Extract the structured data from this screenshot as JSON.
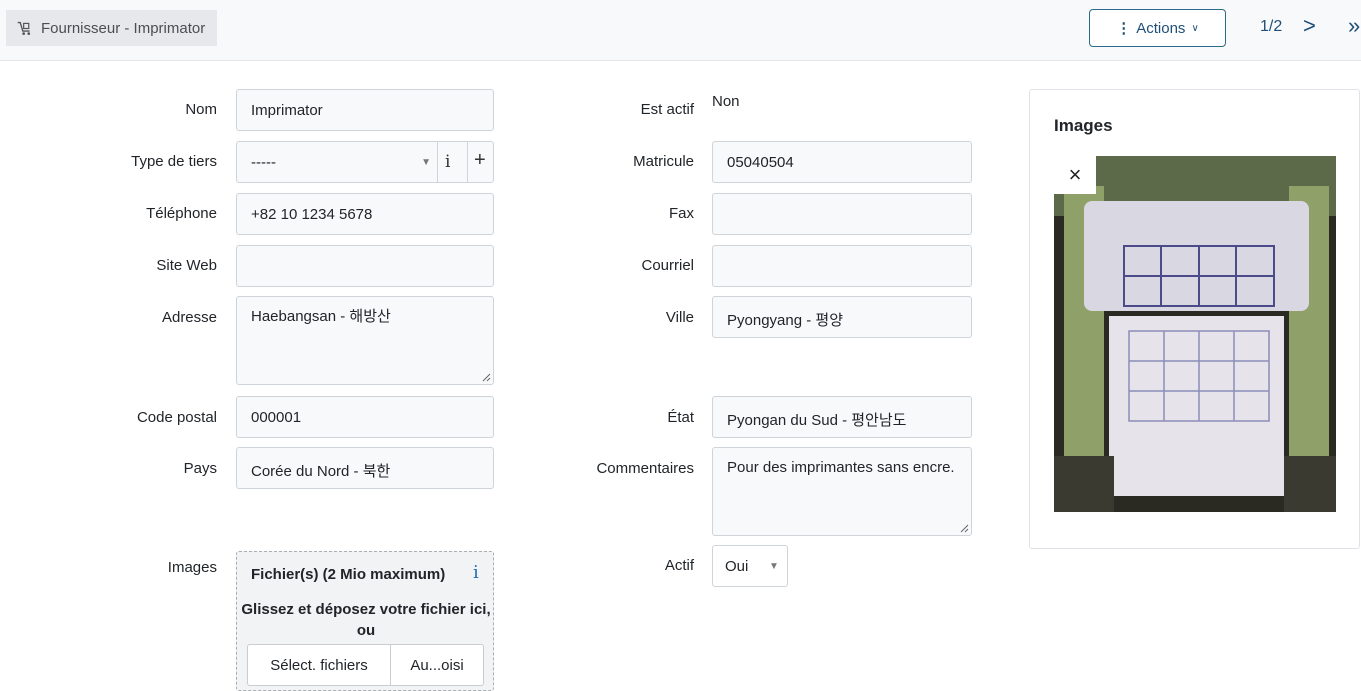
{
  "header": {
    "breadcrumb": "Fournisseur - Imprimator",
    "actions_label": "Actions",
    "pager": "1/2",
    "prev_label": ">",
    "next_label": "»"
  },
  "form": {
    "nom": {
      "label": "Nom",
      "value": "Imprimator"
    },
    "type_tiers": {
      "label": "Type de tiers",
      "value": "-----",
      "info": "i",
      "add": "+"
    },
    "telephone": {
      "label": "Téléphone",
      "value": "+82 10 1234 5678"
    },
    "site_web": {
      "label": "Site Web",
      "value": ""
    },
    "adresse": {
      "label": "Adresse",
      "value": "Haebangsan - 해방산"
    },
    "code_postal": {
      "label": "Code postal",
      "value": "000001"
    },
    "pays": {
      "label": "Pays",
      "value": "Corée du Nord - 북한"
    },
    "images": {
      "label": "Images"
    },
    "est_actif": {
      "label": "Est actif",
      "value": "Non"
    },
    "matricule": {
      "label": "Matricule",
      "value": "05040504"
    },
    "fax": {
      "label": "Fax",
      "value": ""
    },
    "courriel": {
      "label": "Courriel",
      "value": ""
    },
    "ville": {
      "label": "Ville",
      "value": "Pyongyang - 평양"
    },
    "etat": {
      "label": "État",
      "value": "Pyongan du Sud - 평안남도"
    },
    "commentaires": {
      "label": "Commentaires",
      "value": "Pour des imprimantes sans encre."
    },
    "actif": {
      "label": "Actif",
      "value": "Oui"
    }
  },
  "dropzone": {
    "title": "Fichier(s) (2 Mio maximum)",
    "info": "i",
    "text": "Glissez et déposez votre fichier ici, ou",
    "select_button": "Sélect. fichiers",
    "status": "Au...oisi"
  },
  "image_card": {
    "title": "Images",
    "close": "×"
  }
}
